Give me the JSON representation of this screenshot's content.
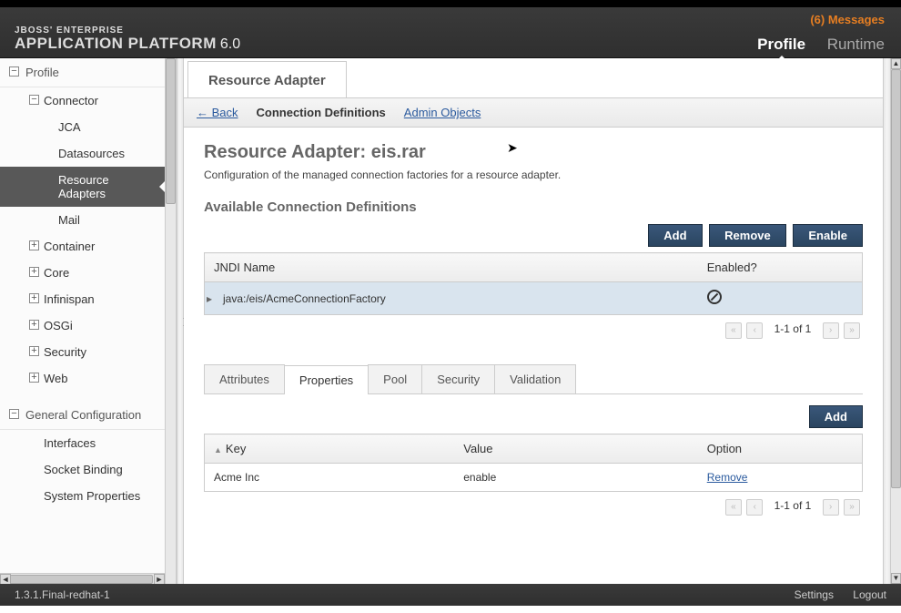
{
  "header": {
    "brand_line1": "JBOSS' ENTERPRISE",
    "brand_line2": "APPLICATION PLATFORM",
    "version": "6.0",
    "messages": "(6) Messages",
    "nav": {
      "profile": "Profile",
      "runtime": "Runtime"
    }
  },
  "sidebar": {
    "profile": {
      "title": "Profile",
      "items": [
        {
          "label": "Connector",
          "expanded": true,
          "children": [
            {
              "label": "JCA"
            },
            {
              "label": "Datasources"
            },
            {
              "label": "Resource Adapters",
              "active": true
            },
            {
              "label": "Mail"
            }
          ]
        },
        {
          "label": "Container"
        },
        {
          "label": "Core"
        },
        {
          "label": "Infinispan"
        },
        {
          "label": "OSGi"
        },
        {
          "label": "Security"
        },
        {
          "label": "Web"
        }
      ]
    },
    "general": {
      "title": "General Configuration",
      "items": [
        {
          "label": "Interfaces"
        },
        {
          "label": "Socket Binding"
        },
        {
          "label": "System Properties"
        }
      ]
    }
  },
  "content": {
    "main_tab": "Resource Adapter",
    "crumbs": {
      "back": "← Back",
      "conn_def": "Connection Definitions",
      "admin_obj": "Admin Objects"
    },
    "page_title": "Resource Adapter: eis.rar",
    "page_desc": "Configuration of the managed connection factories for a resource adapter.",
    "section_title": "Available Connection Definitions",
    "actions": {
      "add": "Add",
      "remove": "Remove",
      "enable": "Enable"
    },
    "table1": {
      "cols": {
        "jndi": "JNDI Name",
        "enabled": "Enabled?"
      },
      "rows": [
        {
          "jndi": "java:/eis/AcmeConnectionFactory",
          "enabled": false
        }
      ],
      "pager": "1-1 of 1"
    },
    "sub_tabs": {
      "attributes": "Attributes",
      "properties": "Properties",
      "pool": "Pool",
      "security": "Security",
      "validation": "Validation"
    },
    "actions2": {
      "add": "Add"
    },
    "table2": {
      "cols": {
        "key": "Key",
        "value": "Value",
        "option": "Option"
      },
      "rows": [
        {
          "key": "Acme Inc",
          "value": "enable",
          "option": "Remove"
        }
      ],
      "pager": "1-1 of 1"
    }
  },
  "footer": {
    "version": "1.3.1.Final-redhat-1",
    "settings": "Settings",
    "logout": "Logout"
  }
}
